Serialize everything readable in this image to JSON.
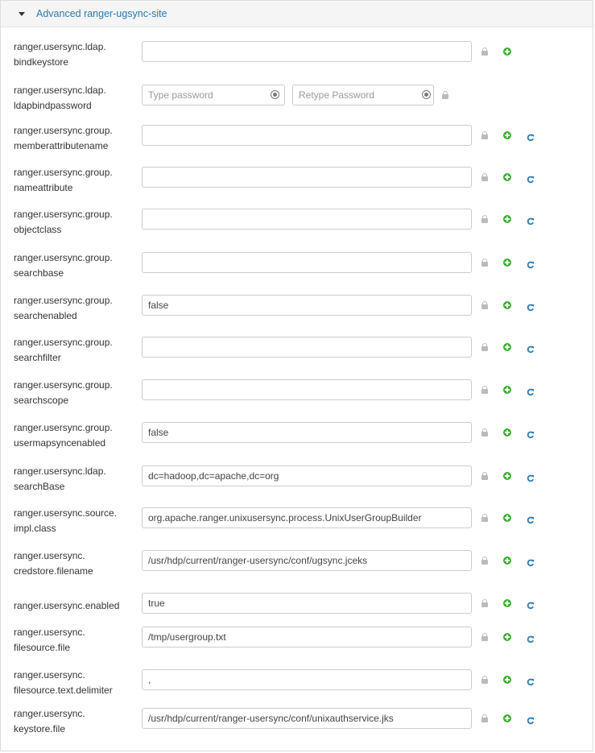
{
  "section": {
    "title": "Advanced ranger-ugsync-site"
  },
  "password_row": {
    "label": "ranger.usersync.ldap.\nldapbindpassword",
    "password_placeholder": "Type password",
    "retype_placeholder": "Retype Password"
  },
  "rows": [
    {
      "label": "ranger.usersync.ldap.\nbindkeystore",
      "value": "",
      "lock": true,
      "add": true,
      "reset": false
    },
    {
      "label": "ranger.usersync.group.\nmemberattributename",
      "value": "",
      "lock": true,
      "add": true,
      "reset": true
    },
    {
      "label": "ranger.usersync.group.\nnameattribute",
      "value": "",
      "lock": true,
      "add": true,
      "reset": true
    },
    {
      "label": "ranger.usersync.group.\nobjectclass",
      "value": "",
      "lock": true,
      "add": true,
      "reset": true
    },
    {
      "label": "ranger.usersync.group.\nsearchbase",
      "value": "",
      "lock": true,
      "add": true,
      "reset": true
    },
    {
      "label": "ranger.usersync.group.\nsearchenabled",
      "value": "false",
      "lock": true,
      "add": true,
      "reset": true
    },
    {
      "label": "ranger.usersync.group.\nsearchfilter",
      "value": "",
      "lock": true,
      "add": true,
      "reset": true
    },
    {
      "label": "ranger.usersync.group.\nsearchscope",
      "value": "",
      "lock": true,
      "add": true,
      "reset": true
    },
    {
      "label": "ranger.usersync.group.\nusermapsyncenabled",
      "value": "false",
      "lock": true,
      "add": true,
      "reset": true
    },
    {
      "label": "ranger.usersync.ldap.\nsearchBase",
      "value": "dc=hadoop,dc=apache,dc=org",
      "lock": true,
      "add": true,
      "reset": true
    },
    {
      "label": "ranger.usersync.source.\nimpl.class",
      "value": "org.apache.ranger.unixusersync.process.UnixUserGroupBuilder",
      "lock": true,
      "add": true,
      "reset": true
    },
    {
      "label": "ranger.usersync.\ncredstore.filename",
      "value": "/usr/hdp/current/ranger-usersync/conf/ugsync.jceks",
      "lock": true,
      "add": true,
      "reset": true
    },
    {
      "label": "ranger.usersync.enabled",
      "value": "true",
      "lock": true,
      "add": true,
      "reset": true
    },
    {
      "label": "ranger.usersync.\nfilesource.file",
      "value": "/tmp/usergroup.txt",
      "lock": true,
      "add": true,
      "reset": true
    },
    {
      "label": "ranger.usersync.\nfilesource.text.delimiter",
      "value": ",",
      "lock": true,
      "add": true,
      "reset": true
    },
    {
      "label": "ranger.usersync.\nkeystore.file",
      "value": "/usr/hdp/current/ranger-usersync/conf/unixauthservice.jks",
      "lock": true,
      "add": true,
      "reset": true
    }
  ],
  "icons": {
    "caret": "caret-down-icon",
    "lock": "lock-icon",
    "add": "plus-circle-icon",
    "reset": "refresh-icon",
    "eye": "eye-icon"
  },
  "colors": {
    "title": "#2a7ab0",
    "add": "#3cb030",
    "reset": "#2a7ab0",
    "lock": "#bbbbbb"
  }
}
